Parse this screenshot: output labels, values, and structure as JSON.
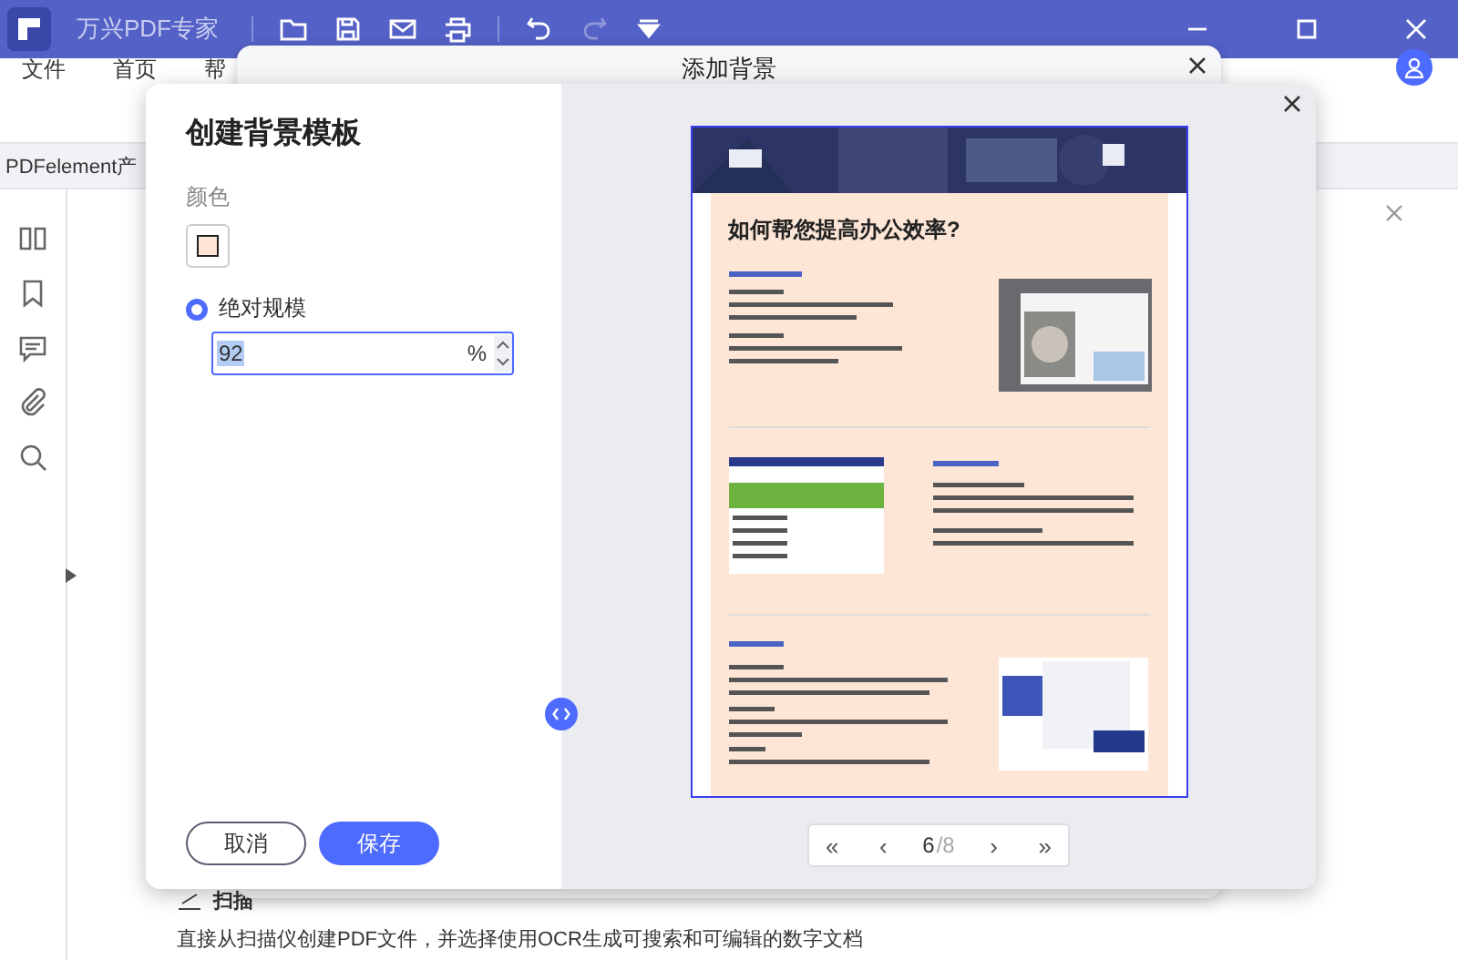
{
  "app": {
    "title": "万兴PDF专家",
    "menu": [
      "文件",
      "首页",
      "帮"
    ]
  },
  "doc_tab": "PDFelement产",
  "background_doc": {
    "heading": "扫描",
    "body": "直接从扫描仪创建PDF文件，并选择使用OCR生成可搜索和可编辑的数字文档"
  },
  "back_dialog": {
    "title": "添加背景"
  },
  "dialog": {
    "title": "创建背景模板",
    "color_label": "颜色",
    "scale_option": {
      "label": "绝对规模",
      "selected": true
    },
    "scale_value": "92",
    "unit": "%",
    "buttons": [
      {
        "label": "取消",
        "kind": "secondary"
      },
      {
        "label": "保存",
        "kind": "primary"
      }
    ]
  },
  "preview": {
    "heading": "如何帮您提高办公效率?",
    "pagination": {
      "first": "«",
      "prev": "‹",
      "current": "6",
      "total": "/8",
      "next": "›",
      "last": "»"
    }
  }
}
